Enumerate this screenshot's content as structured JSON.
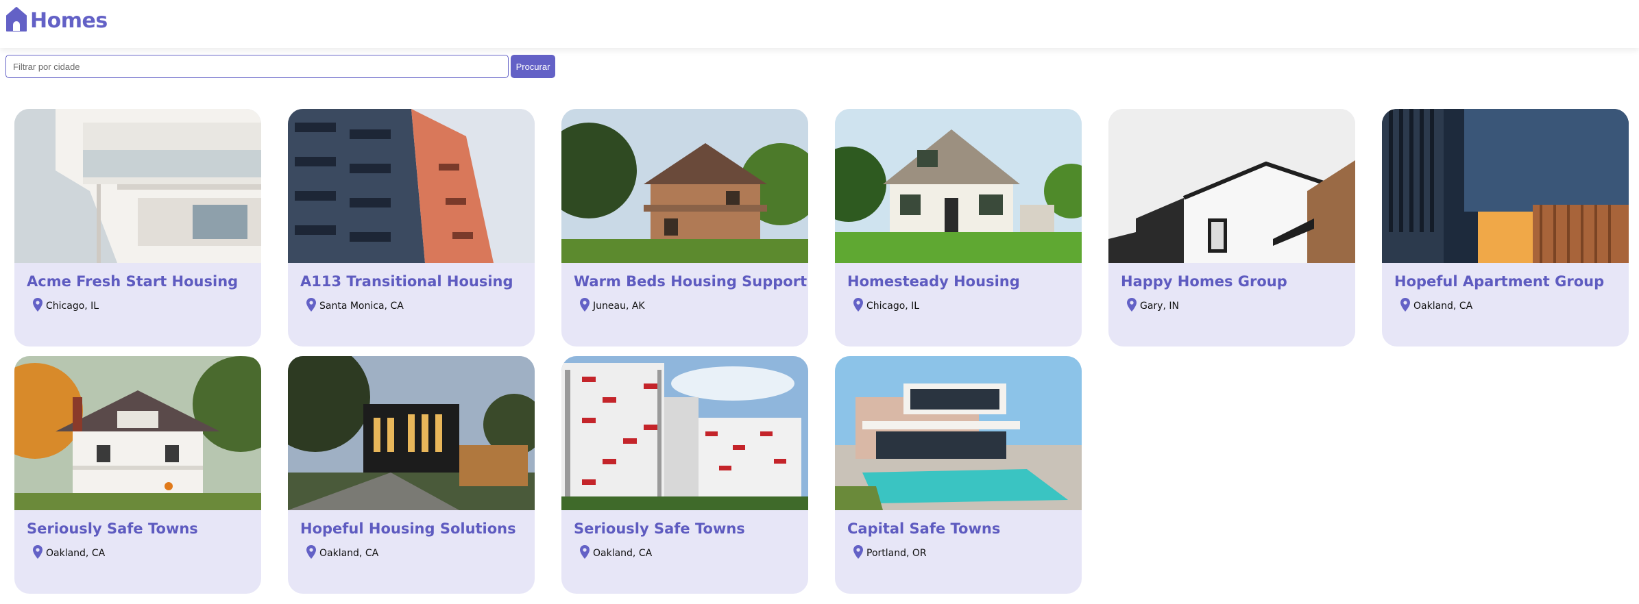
{
  "brand": {
    "name": "Homes",
    "icon": "house-icon",
    "color": "#6361c6"
  },
  "search": {
    "placeholder": "Filtrar por cidade",
    "value": "",
    "button_label": "Procurar"
  },
  "accent": "#6361c6",
  "card_bg": "#e7e6f7",
  "listings": [
    {
      "title": "Acme Fresh Start Housing",
      "location": "Chicago, IL",
      "photo": "white-balcony-building"
    },
    {
      "title": "A113 Transitional Housing",
      "location": "Santa Monica, CA",
      "photo": "blue-balcony-tower"
    },
    {
      "title": "Warm Beds Housing Support",
      "location": "Juneau, AK",
      "photo": "victorian-brick-house"
    },
    {
      "title": "Homesteady Housing",
      "location": "Chicago, IL",
      "photo": "white-cottage"
    },
    {
      "title": "Happy Homes Group",
      "location": "Gary, IN",
      "photo": "modern-white-house"
    },
    {
      "title": "Hopeful Apartment Group",
      "location": "Oakland, CA",
      "photo": "dark-modern-facade"
    },
    {
      "title": "Seriously Safe Towns",
      "location": "Oakland, CA",
      "photo": "craftsman-house"
    },
    {
      "title": "Hopeful Housing Solutions",
      "location": "Oakland, CA",
      "photo": "modern-house-dusk"
    },
    {
      "title": "Seriously Safe Towns",
      "location": "Oakland, CA",
      "photo": "red-white-highrise"
    },
    {
      "title": "Capital Safe Towns",
      "location": "Portland, OR",
      "photo": "villa-with-pool"
    }
  ]
}
